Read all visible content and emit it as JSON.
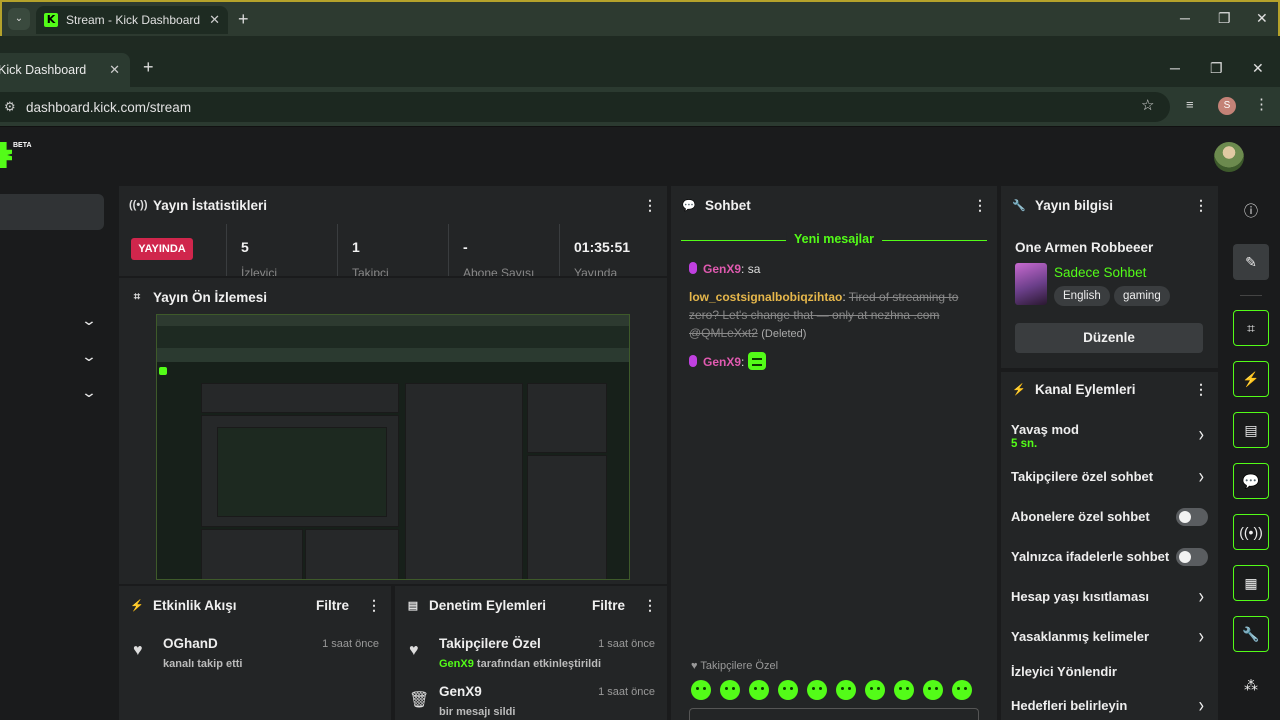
{
  "outer_window": {
    "tab_title": "Stream - Kick Dashboard",
    "new_tab": "+",
    "dropdown": "⌄"
  },
  "browser": {
    "tab_title": "Kick Dashboard",
    "url": "dashboard.kick.com/stream",
    "profile_letter": "S"
  },
  "header": {
    "beta": "BETA"
  },
  "stats": {
    "title": "Yayın İstatistikleri",
    "live_badge": "YAYINDA",
    "items": [
      {
        "value": "5",
        "label": "İzleyici"
      },
      {
        "value": "1",
        "label": "Takipçi"
      },
      {
        "value": "-",
        "label": "Abone Sayısı"
      },
      {
        "value": "01:35:51",
        "label": "Yayında"
      }
    ]
  },
  "preview": {
    "title": "Yayın Ön İzlemesi"
  },
  "activity": {
    "title": "Etkinlik Akışı",
    "filter": "Filtre",
    "items": [
      {
        "name": "OGhanD",
        "action": "kanalı takip etti",
        "time": "1 saat önce"
      }
    ]
  },
  "moderation": {
    "title": "Denetim Eylemleri",
    "filter": "Filtre",
    "items": [
      {
        "title": "Takipçilere Özel",
        "user": "GenX9",
        "action": " tarafından etkinleştirildi",
        "time": "1 saat önce"
      },
      {
        "title": "GenX9",
        "action": "bir mesajı sildi",
        "time": "1 saat önce"
      }
    ]
  },
  "chat": {
    "title": "Sohbet",
    "new_messages": "Yeni mesajlar",
    "messages": [
      {
        "user": "GenX9",
        "sep": ": ",
        "text": "sa"
      },
      {
        "user": "low_costsignalbobiqzihtao",
        "sep": ": ",
        "text": "Tired of streaming to zero? Let's change that — only at nezhna .com @QMLeXxt2",
        "note": "(Deleted)"
      },
      {
        "user": "GenX9",
        "sep": ": "
      }
    ],
    "follower_only": "Takipçilere Özel"
  },
  "stream_info": {
    "title": "Yayın bilgisi",
    "stream_title": "One Armen Robbeeer",
    "category": "Sadece Sohbet",
    "tags": [
      "English",
      "gaming"
    ],
    "edit": "Düzenle"
  },
  "channel_actions": {
    "title": "Kanal Eylemleri",
    "items": [
      {
        "label": "Yavaş mod",
        "sub": "5 sn."
      },
      {
        "label": "Takipçilere özel sohbet"
      },
      {
        "label": "Abonelere özel sohbet",
        "toggle": false
      },
      {
        "label": "Yalnızca ifadelerle sohbet",
        "toggle": false
      },
      {
        "label": "Hesap yaşı kısıtlaması"
      },
      {
        "label": "Yasaklanmış kelimeler"
      },
      {
        "label": "İzleyici Yönlendir"
      },
      {
        "label": "Hedefleri belirleyin"
      }
    ]
  },
  "colors": {
    "accent": "#53fc18",
    "live": "#d0264c",
    "panel": "#232526",
    "bg": "#1a1b1c"
  }
}
